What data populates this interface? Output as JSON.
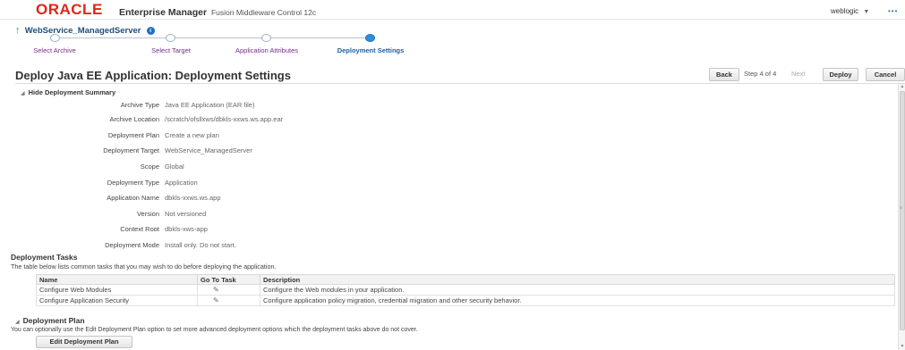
{
  "header": {
    "brand": "ORACLE",
    "product": "Enterprise Manager",
    "product_sub": "Fusion Middleware Control 12c",
    "user": "weblogic",
    "user_caret": "▼",
    "more": "•••"
  },
  "target": {
    "arrow": "↑",
    "name": "WebService_ManagedServer",
    "info": "i"
  },
  "train": {
    "steps": [
      {
        "label": "Select Archive"
      },
      {
        "label": "Select Target"
      },
      {
        "label": "Application Attributes"
      },
      {
        "label": "Deployment Settings"
      }
    ],
    "current_step": 4
  },
  "page": {
    "title": "Deploy Java EE Application: Deployment Settings",
    "back_label": "Back",
    "step_text": "Step 4 of 4",
    "next_label": "Next",
    "deploy_label": "Deploy",
    "cancel_label": "Cancel"
  },
  "summary": {
    "toggle_label": "Hide Deployment Summary",
    "rows": [
      {
        "label": "Archive Type",
        "value": "Java EE Application (EAR file)"
      },
      {
        "label": "Archive Location",
        "value": "/scratch/ofsllxws/dbkls-xxws.ws.app.ear"
      },
      {
        "label": "Deployment Plan",
        "value": "Create a new plan"
      },
      {
        "label": "Deployment Target",
        "value": "WebService_ManagedServer"
      },
      {
        "label": "Scope",
        "value": "Global"
      },
      {
        "label": "Deployment Type",
        "value": "Application"
      },
      {
        "label": "Application Name",
        "value": "dbkls-xxws.ws.app"
      },
      {
        "label": "Version",
        "value": "Not versioned"
      },
      {
        "label": "Context Root",
        "value": "dbkls-xws-app"
      },
      {
        "label": "Deployment Mode",
        "value": "Install only. Do not start."
      }
    ]
  },
  "tasks": {
    "heading": "Deployment Tasks",
    "description": "The table below lists common tasks that you may wish to do before deploying the application.",
    "columns": {
      "name": "Name",
      "go": "Go To Task",
      "description": "Description"
    },
    "rows": [
      {
        "name": "Configure Web Modules",
        "description": "Configure the Web modules in your application."
      },
      {
        "name": "Configure Application Security",
        "description": "Configure application policy migration, credential migration and other security behavior."
      }
    ]
  },
  "plan": {
    "heading": "Deployment Plan",
    "description": "You can optionally use the Edit Deployment Plan option to set more advanced deployment options which the deployment tasks above do not cover.",
    "edit_label": "Edit Deployment Plan"
  },
  "icons": {
    "pencil": "✎",
    "triangle": "◢"
  }
}
